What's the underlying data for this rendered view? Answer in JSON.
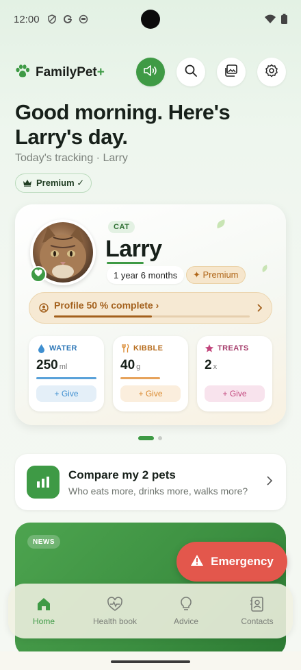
{
  "status_bar": {
    "time": "12:00"
  },
  "header": {
    "brand_name": "FamilyPet",
    "brand_plus": "+",
    "accent_color": "#3e9a45"
  },
  "greeting": {
    "title": "Good morning. Here's Larry's day.",
    "subtitle": "Today's tracking · Larry",
    "premium_chip": "Premium ✓"
  },
  "pet_card": {
    "species": "CAT",
    "name": "Larry",
    "age": "1 year 6 months",
    "premium_label": "✦ Premium",
    "profile_text": "Profile 50 % complete ›",
    "profile_progress": 0.5,
    "stats": [
      {
        "label": "WATER",
        "value": "250",
        "unit": "ml",
        "button": "+ Give",
        "color": "#3f8fd0"
      },
      {
        "label": "KIBBLE",
        "value": "40",
        "unit": "g",
        "button": "+ Give",
        "color": "#d9872c"
      },
      {
        "label": "TREATS",
        "value": "2",
        "unit": "x",
        "button": "+ Give",
        "color": "#c2457c"
      }
    ]
  },
  "compare": {
    "title": "Compare my 2 pets",
    "subtitle": "Who eats more, drinks more, walks more?"
  },
  "news": {
    "tag": "NEWS"
  },
  "emergency": {
    "label": "Emergency"
  },
  "bottom_nav": {
    "items": [
      {
        "label": "Home",
        "icon": "home-icon"
      },
      {
        "label": "Health book",
        "icon": "heart-pulse-icon"
      },
      {
        "label": "Advice",
        "icon": "lightbulb-icon"
      },
      {
        "label": "Contacts",
        "icon": "contacts-icon"
      }
    ]
  }
}
